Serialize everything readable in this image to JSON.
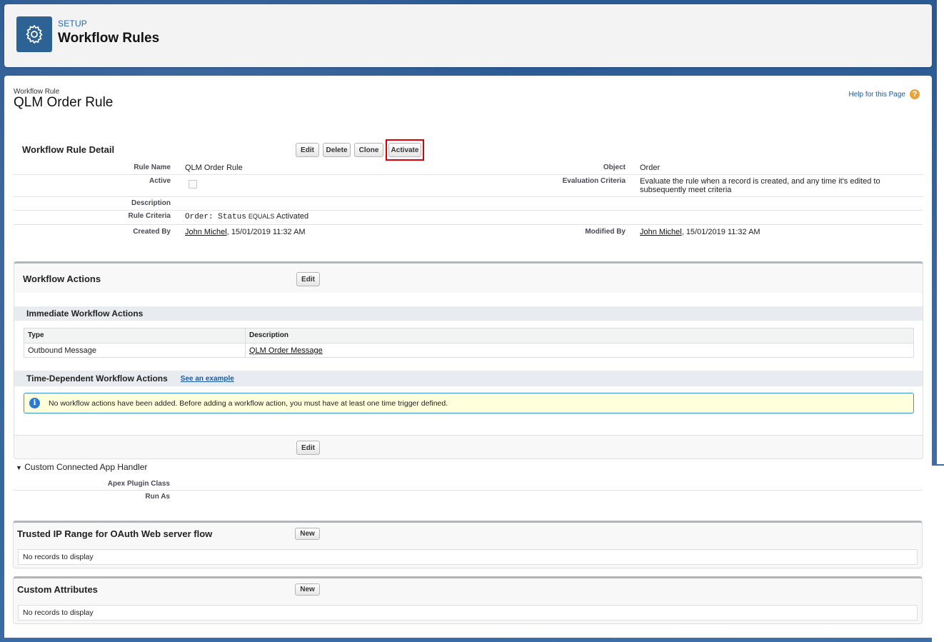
{
  "header": {
    "setup_label": "SETUP",
    "title": "Workflow Rules",
    "icon": "gear-icon"
  },
  "record": {
    "type_label": "Workflow Rule",
    "title": "QLM Order Rule",
    "help_label": "Help for this Page",
    "help_icon": "?"
  },
  "detail": {
    "section_title": "Workflow Rule Detail",
    "buttons": {
      "edit": "Edit",
      "delete": "Delete",
      "clone": "Clone",
      "activate": "Activate"
    },
    "fields": {
      "rule_name_label": "Rule Name",
      "rule_name": "QLM Order Rule",
      "object_label": "Object",
      "object": "Order",
      "active_label": "Active",
      "eval_label": "Evaluation Criteria",
      "eval_line1": "Evaluate the rule when a record is created, and any time it's edited to",
      "eval_line2": "subsequently meet criteria",
      "description_label": "Description",
      "rule_criteria_label": "Rule Criteria",
      "criteria_field": "Order: Status",
      "criteria_op": "EQUALS",
      "criteria_value": "Activated",
      "created_by_label": "Created By",
      "created_by_user": "John Michel",
      "created_by_date": ", 15/01/2019 11:32 AM",
      "modified_by_label": "Modified By",
      "modified_by_user": "John Michel",
      "modified_by_date": ", 15/01/2019 11:32 AM"
    }
  },
  "actions": {
    "title": "Workflow Actions",
    "edit": "Edit",
    "immediate_title": "Immediate Workflow Actions",
    "table": {
      "col_type": "Type",
      "col_desc": "Description",
      "row_type": "Outbound Message",
      "row_desc": "QLM Order Message"
    },
    "time_title": "Time-Dependent Workflow Actions",
    "see_example": "See an example",
    "info_icon": "i",
    "info_text": "No workflow actions have been added. Before adding a workflow action, you must have at least one time trigger defined.",
    "edit_bottom": "Edit"
  },
  "handler": {
    "title": "Custom Connected App Handler",
    "apex_label": "Apex Plugin Class",
    "run_as_label": "Run As"
  },
  "trusted": {
    "title": "Trusted IP Range for OAuth Web server flow",
    "new": "New",
    "empty": "No records to display"
  },
  "custom_attr": {
    "title": "Custom Attributes",
    "new": "New",
    "empty": "No records to display"
  }
}
